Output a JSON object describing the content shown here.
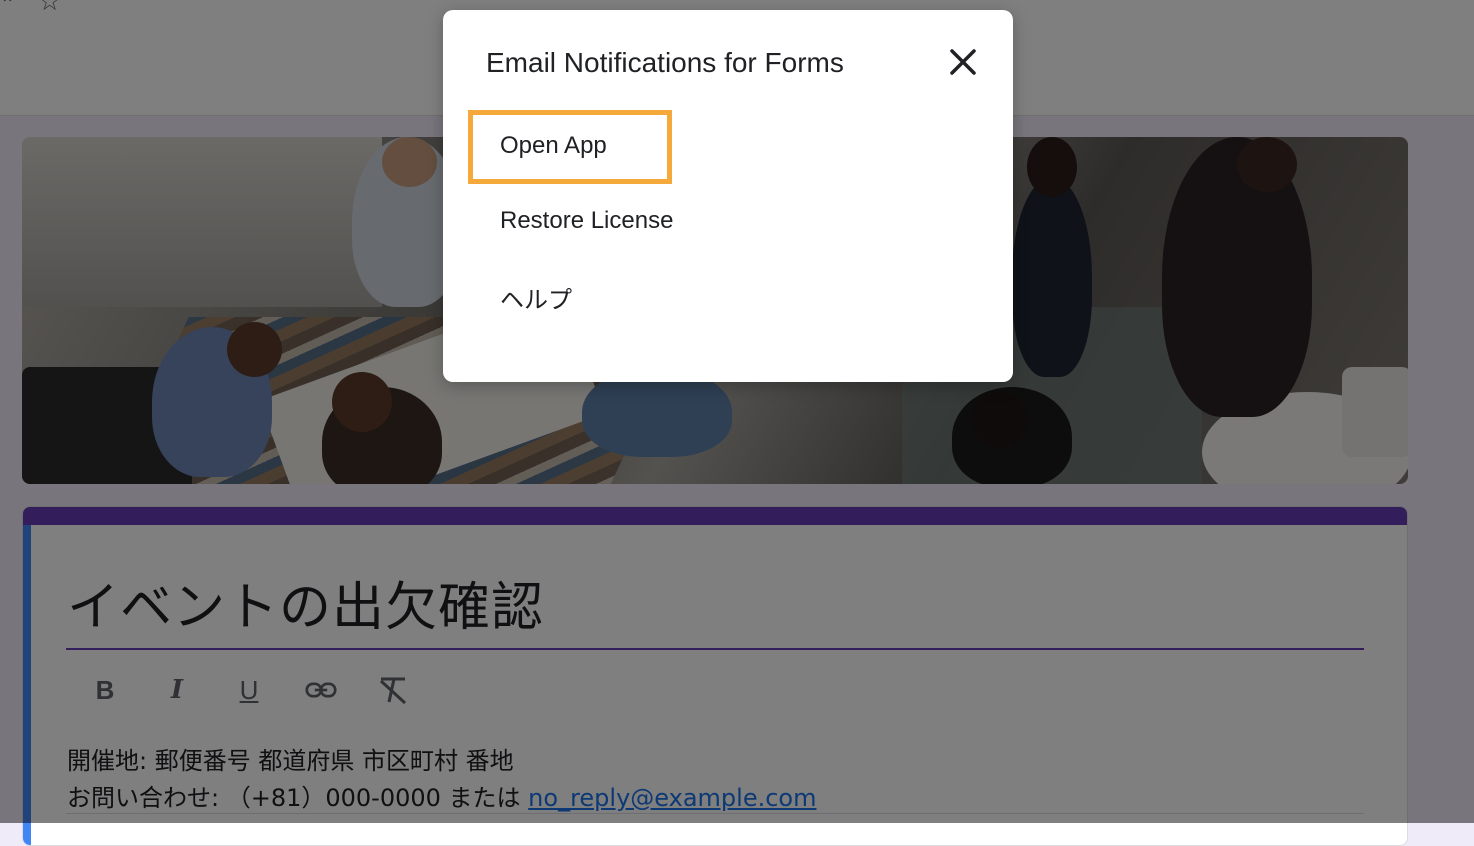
{
  "form": {
    "title": "イベントの出欠確認",
    "description_line1": "開催地: 郵便番号 都道府県 市区町村 番地",
    "description_line2_prefix": "お問い合わせ: （+81）000-0000 または ",
    "description_email": "no_reply@example.com",
    "toolbar": {
      "bold": "B",
      "italic": "I",
      "underline": "U"
    }
  },
  "dialog": {
    "title": "Email Notifications for Forms",
    "items": [
      {
        "label": "Open App",
        "highlighted": true
      },
      {
        "label": "Restore License",
        "highlighted": false
      },
      {
        "label": "ヘルプ",
        "highlighted": false
      }
    ]
  },
  "colors": {
    "theme": "#673ab7",
    "accent_left": "#4285f4",
    "highlight": "#f4a93a",
    "link": "#1a73e8"
  }
}
